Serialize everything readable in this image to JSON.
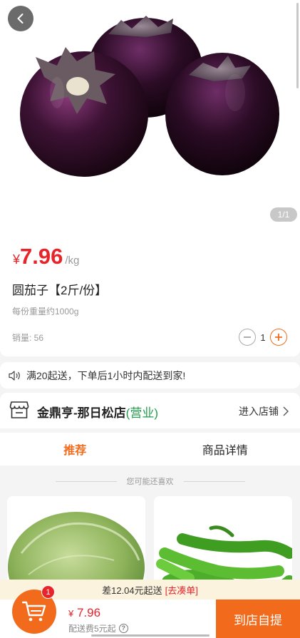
{
  "product": {
    "pager": "1/1",
    "price_symbol": "¥",
    "price": "7.96",
    "unit": "/kg",
    "name": "圆茄子【2斤/份】",
    "weight_note": "每份重量约1000g",
    "sales_label": "销量: 56",
    "quantity": "1"
  },
  "notice": {
    "text": "满20起送，下单后1小时内配送到家!"
  },
  "store": {
    "name": "金鼎亨-那日松店",
    "status": "(营业)",
    "enter_label": "进入店铺"
  },
  "tabs": [
    {
      "label": "推荐",
      "active": true
    },
    {
      "label": "商品详情",
      "active": false
    }
  ],
  "recommend": {
    "title": "您可能还喜欢"
  },
  "cart": {
    "tip_prefix": "差12.04元起送",
    "tip_link": "[去凑单]",
    "badge": "1",
    "total_symbol": "¥",
    "total": "7.96",
    "delivery_fee": "配送费5元起",
    "pickup_label": "到店自提"
  },
  "colors": {
    "accent": "#f26b1d",
    "price": "#e8232a",
    "open_status": "#1f9e4a"
  },
  "icons": [
    "back-arrow-icon",
    "speaker-icon",
    "store-icon",
    "chevron-right-icon",
    "minus-icon",
    "plus-icon",
    "cart-icon",
    "help-icon"
  ]
}
